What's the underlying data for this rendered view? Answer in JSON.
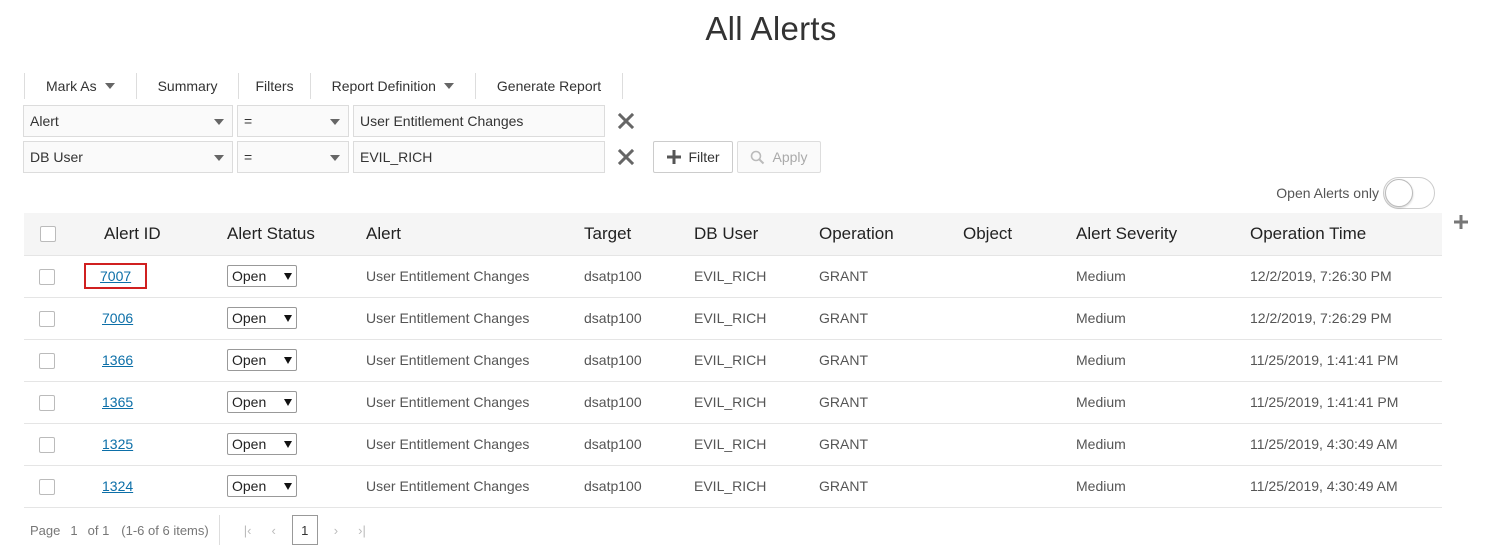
{
  "page_title": "All Alerts",
  "toolbar": {
    "mark_as": "Mark As",
    "summary": "Summary",
    "filters": "Filters",
    "report_definition": "Report Definition",
    "generate_report": "Generate Report"
  },
  "filters": [
    {
      "field": "Alert",
      "operator": "=",
      "value": "User Entitlement Changes"
    },
    {
      "field": "DB User",
      "operator": "=",
      "value": "EVIL_RICH"
    }
  ],
  "filter_button": "Filter",
  "apply_button": "Apply",
  "toggle": {
    "label": "Open Alerts only",
    "on": false
  },
  "table": {
    "columns": [
      "Alert ID",
      "Alert Status",
      "Alert",
      "Target",
      "DB User",
      "Operation",
      "Object",
      "Alert Severity",
      "Operation Time"
    ],
    "rows": [
      {
        "id": "7007",
        "status": "Open",
        "alert": "User Entitlement Changes",
        "target": "dsatp100",
        "db_user": "EVIL_RICH",
        "operation": "GRANT",
        "object": "",
        "severity": "Medium",
        "time": "12/2/2019, 7:26:30 PM"
      },
      {
        "id": "7006",
        "status": "Open",
        "alert": "User Entitlement Changes",
        "target": "dsatp100",
        "db_user": "EVIL_RICH",
        "operation": "GRANT",
        "object": "",
        "severity": "Medium",
        "time": "12/2/2019, 7:26:29 PM"
      },
      {
        "id": "1366",
        "status": "Open",
        "alert": "User Entitlement Changes",
        "target": "dsatp100",
        "db_user": "EVIL_RICH",
        "operation": "GRANT",
        "object": "",
        "severity": "Medium",
        "time": "11/25/2019, 1:41:41 PM"
      },
      {
        "id": "1365",
        "status": "Open",
        "alert": "User Entitlement Changes",
        "target": "dsatp100",
        "db_user": "EVIL_RICH",
        "operation": "GRANT",
        "object": "",
        "severity": "Medium",
        "time": "11/25/2019, 1:41:41 PM"
      },
      {
        "id": "1325",
        "status": "Open",
        "alert": "User Entitlement Changes",
        "target": "dsatp100",
        "db_user": "EVIL_RICH",
        "operation": "GRANT",
        "object": "",
        "severity": "Medium",
        "time": "11/25/2019, 4:30:49 AM"
      },
      {
        "id": "1324",
        "status": "Open",
        "alert": "User Entitlement Changes",
        "target": "dsatp100",
        "db_user": "EVIL_RICH",
        "operation": "GRANT",
        "object": "",
        "severity": "Medium",
        "time": "11/25/2019, 4:30:49 AM"
      }
    ]
  },
  "pager": {
    "page_label": "Page",
    "page": "1",
    "of_label": "of 1",
    "items": "(1-6 of 6 items)",
    "current": "1"
  },
  "icons": {
    "dropdown": "chevron-down-icon",
    "remove": "close-icon",
    "add": "plus-icon",
    "search": "search-icon"
  },
  "colors": {
    "link": "#0c6fa8",
    "highlight": "#d02020",
    "header_bg": "#f5f5f5"
  }
}
